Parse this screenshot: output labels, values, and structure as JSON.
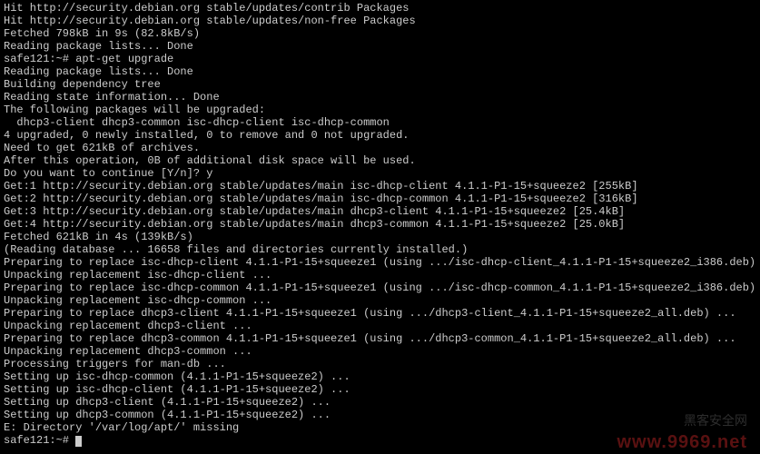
{
  "terminal": {
    "lines": [
      "Hit http://security.debian.org stable/updates/contrib Packages",
      "Hit http://security.debian.org stable/updates/non-free Packages",
      "Fetched 798kB in 9s (82.8kB/s)",
      "Reading package lists... Done",
      "safe121:~# apt-get upgrade",
      "Reading package lists... Done",
      "Building dependency tree",
      "Reading state information... Done",
      "The following packages will be upgraded:",
      "  dhcp3-client dhcp3-common isc-dhcp-client isc-dhcp-common",
      "4 upgraded, 0 newly installed, 0 to remove and 0 not upgraded.",
      "Need to get 621kB of archives.",
      "After this operation, 0B of additional disk space will be used.",
      "Do you want to continue [Y/n]? y",
      "Get:1 http://security.debian.org stable/updates/main isc-dhcp-client 4.1.1-P1-15+squeeze2 [255kB]",
      "Get:2 http://security.debian.org stable/updates/main isc-dhcp-common 4.1.1-P1-15+squeeze2 [316kB]",
      "Get:3 http://security.debian.org stable/updates/main dhcp3-client 4.1.1-P1-15+squeeze2 [25.4kB]",
      "Get:4 http://security.debian.org stable/updates/main dhcp3-common 4.1.1-P1-15+squeeze2 [25.0kB]",
      "Fetched 621kB in 4s (139kB/s)",
      "(Reading database ... 16658 files and directories currently installed.)",
      "Preparing to replace isc-dhcp-client 4.1.1-P1-15+squeeze1 (using .../isc-dhcp-client_4.1.1-P1-15+squeeze2_i386.deb) ...",
      "Unpacking replacement isc-dhcp-client ...",
      "Preparing to replace isc-dhcp-common 4.1.1-P1-15+squeeze1 (using .../isc-dhcp-common_4.1.1-P1-15+squeeze2_i386.deb) ...",
      "Unpacking replacement isc-dhcp-common ...",
      "Preparing to replace dhcp3-client 4.1.1-P1-15+squeeze1 (using .../dhcp3-client_4.1.1-P1-15+squeeze2_all.deb) ...",
      "Unpacking replacement dhcp3-client ...",
      "Preparing to replace dhcp3-common 4.1.1-P1-15+squeeze1 (using .../dhcp3-common_4.1.1-P1-15+squeeze2_all.deb) ...",
      "Unpacking replacement dhcp3-common ...",
      "Processing triggers for man-db ...",
      "Setting up isc-dhcp-common (4.1.1-P1-15+squeeze2) ...",
      "Setting up isc-dhcp-client (4.1.1-P1-15+squeeze2) ...",
      "Setting up dhcp3-client (4.1.1-P1-15+squeeze2) ...",
      "Setting up dhcp3-common (4.1.1-P1-15+squeeze2) ...",
      "E: Directory '/var/log/apt/' missing"
    ],
    "prompt": "safe121:~# "
  },
  "watermark": {
    "main": "www.9969.net",
    "sub": "黑客安全网"
  }
}
